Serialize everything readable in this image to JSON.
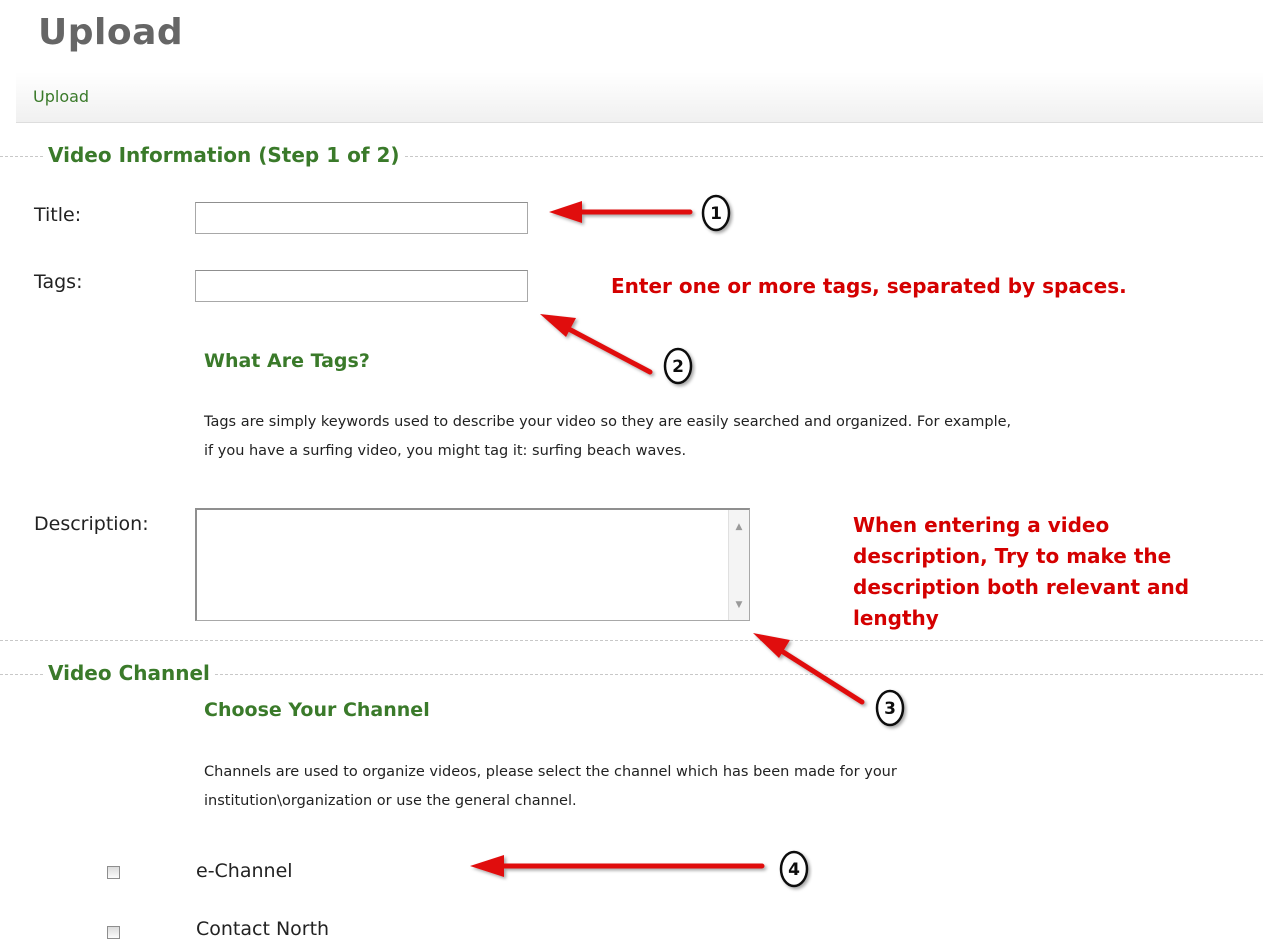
{
  "page": {
    "title": "Upload"
  },
  "breadcrumb": {
    "link": "Upload"
  },
  "video_info": {
    "legend": "Video Information (Step 1 of 2)",
    "title_label": "Title:",
    "title_value": "",
    "tags_label": "Tags:",
    "tags_value": "",
    "tags_note": "Enter one or more tags, separated by spaces.",
    "tags_help_heading": "What Are Tags?",
    "tags_help_line1": "Tags are simply keywords used to describe your video so they are easily searched and organized. For example,",
    "tags_help_line2": "if you have a surfing video, you might tag it: surfing beach waves.",
    "description_label": "Description:",
    "description_value": "",
    "description_note_lines": [
      "When entering a video",
      "description, Try to make the",
      "description both relevant and",
      "lengthy"
    ]
  },
  "video_channel": {
    "legend": "Video Channel",
    "help_heading": "Choose Your Channel",
    "help_line1": "Channels are used to organize videos, please select the channel which has been made for your",
    "help_line2": "institution\\organization or use the general channel.",
    "channels": [
      {
        "label": "e-Channel",
        "checked": false
      },
      {
        "label": "Contact North",
        "checked": false
      }
    ]
  },
  "annotations": {
    "markers": [
      "1",
      "2",
      "3",
      "4"
    ],
    "arrow_color": "#e01010"
  },
  "colors": {
    "green_heading": "#3a7a2a",
    "red_note": "#d40000",
    "title_gray": "#666666"
  }
}
